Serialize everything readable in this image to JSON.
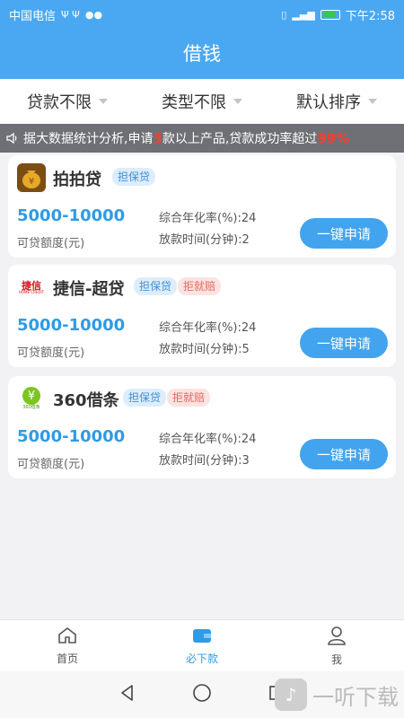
{
  "status_bar": {
    "carrier": "中国电信",
    "time": "下午2:58"
  },
  "header": {
    "title": "借钱"
  },
  "filters": [
    {
      "label": "贷款不限"
    },
    {
      "label": "类型不限"
    },
    {
      "label": "默认排序"
    }
  ],
  "notice": {
    "part1": "据大数据统计分析,申请",
    "count": "3",
    "part2": "款以上产品,贷款成功率超过",
    "percent": "99%"
  },
  "products": [
    {
      "name": "拍拍贷",
      "tags": [
        "担保贷"
      ],
      "amount": "5000-10000",
      "amount_label": "可贷额度(元)",
      "rate": "综合年化率(%):24",
      "time": "放款时间(分钟):2",
      "button": "一键申请",
      "logo_color": "#d08a1c",
      "logo_icon": "money-bag-icon"
    },
    {
      "name": "捷信-超贷",
      "tags": [
        "担保贷",
        "拒就赔"
      ],
      "amount": "5000-10000",
      "amount_label": "可贷额度(元)",
      "rate": "综合年化率(%):24",
      "time": "放款时间(分钟):5",
      "button": "一键申请",
      "logo_text": "捷信",
      "logo_subtext": "HOME CREDIT",
      "logo_color": "#d6141a"
    },
    {
      "name": "360借条",
      "tags": [
        "担保贷",
        "拒就赔"
      ],
      "amount": "5000-10000",
      "amount_label": "可贷额度(元)",
      "rate": "综合年化率(%):24",
      "time": "放款时间(分钟):3",
      "button": "一键申请",
      "logo_text": "¥",
      "logo_subtext": "360借条",
      "logo_color": "#7cc51c"
    }
  ],
  "bottom_nav": [
    {
      "label": "首页",
      "icon": "home-icon"
    },
    {
      "label": "必下款",
      "icon": "wallet-icon",
      "active": true
    },
    {
      "label": "我",
      "icon": "user-icon"
    }
  ],
  "watermark": {
    "text": "一听下载"
  },
  "colors": {
    "accent": "#4aa8f2",
    "button": "#42a4ef",
    "highlight_red": "#ff3b30"
  }
}
